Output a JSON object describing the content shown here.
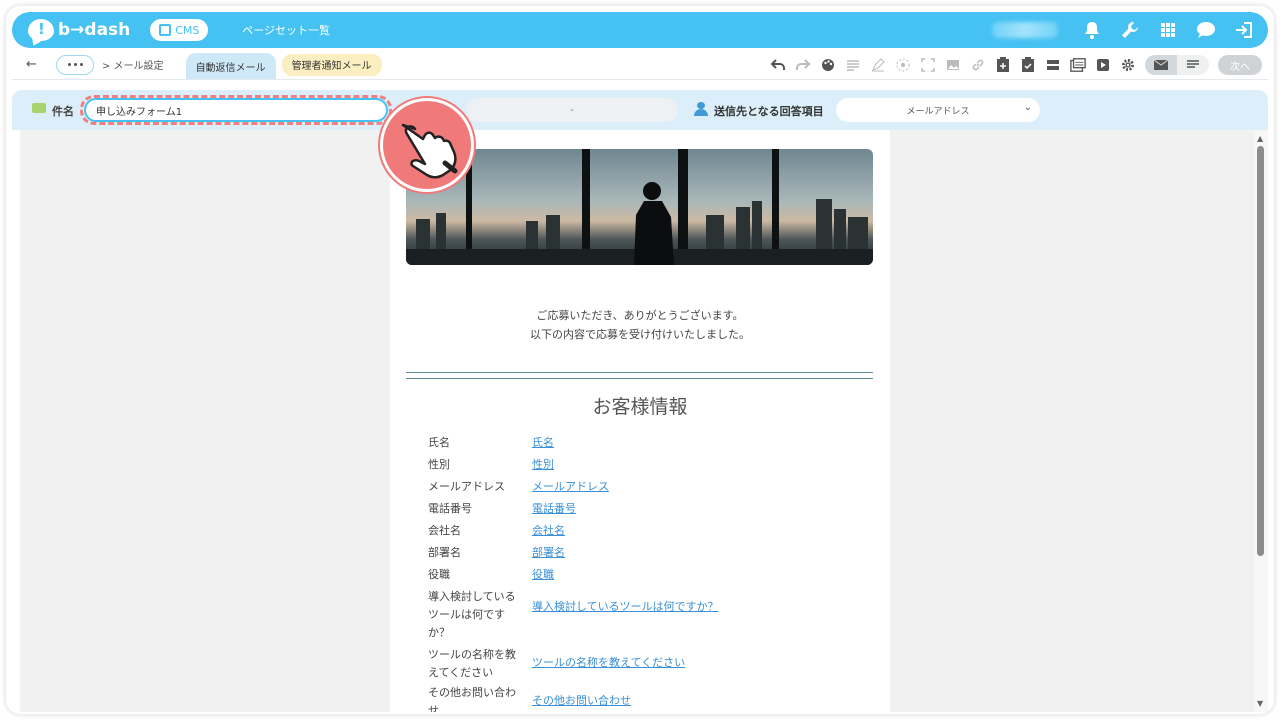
{
  "app": {
    "logo_text": "b→dash",
    "cms_label": "CMS",
    "nav_link": "ページセット一覧"
  },
  "subbar": {
    "crumb": "> メール設定",
    "tabs": [
      "自動返信メール",
      "管理者通知メール"
    ],
    "next_label": "次へ"
  },
  "settings": {
    "subject_label": "件名",
    "subject_value": "申し込みフォーム1",
    "sender_value": "-",
    "recipient_label": "送信先となる回答項目",
    "recipient_selected": "メールアドレス"
  },
  "email": {
    "greeting_line1": "ご応募いただき、ありがとうございます。",
    "greeting_line2": "以下の内容で応募を受け付けいたしました。",
    "section_title": "お客様情報",
    "rows": [
      {
        "label": "氏名",
        "value": "氏名"
      },
      {
        "label": "性別",
        "value": "性別"
      },
      {
        "label": "メールアドレス",
        "value": "メールアドレス"
      },
      {
        "label": "電話番号",
        "value": "電話番号"
      },
      {
        "label": "会社名",
        "value": "会社名"
      },
      {
        "label": "部署名",
        "value": "部署名"
      },
      {
        "label": "役職",
        "value": "役職"
      },
      {
        "label": "導入検討しているツールは何ですか？",
        "value": "導入検討しているツールは何ですか？"
      },
      {
        "label": "ツールの名称を教えてください",
        "value": "ツールの名称を教えてください"
      },
      {
        "label": "その他お問い合わせ",
        "value": "その他お問い合わせ"
      }
    ]
  },
  "colors": {
    "brand": "#45c1f2",
    "highlight": "#f08080",
    "link": "#3a8fd6"
  }
}
